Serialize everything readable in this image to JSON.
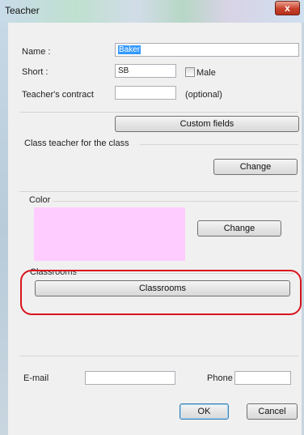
{
  "window": {
    "title": "Teacher",
    "close_glyph": "x"
  },
  "form": {
    "name_label": "Name :",
    "name_value": "Baker",
    "short_label": "Short :",
    "short_value": "SB",
    "male_label": "Male",
    "contract_label": "Teacher's contract",
    "contract_value": "",
    "optional_label": "(optional)",
    "custom_fields_button": "Custom fields"
  },
  "class_teacher": {
    "title": "Class teacher for the class",
    "change_button": "Change"
  },
  "color": {
    "title": "Color",
    "swatch_color": "#ffccff",
    "change_button": "Change"
  },
  "classrooms": {
    "title": "Classrooms",
    "button": "Classrooms"
  },
  "contact": {
    "email_label": "E-mail",
    "email_value": "",
    "phone_label": "Phone",
    "phone_value": ""
  },
  "footer": {
    "ok_button": "OK",
    "cancel_button": "Cancel"
  },
  "colors": {
    "highlight": "#d9141c",
    "selection": "#3399ff"
  }
}
